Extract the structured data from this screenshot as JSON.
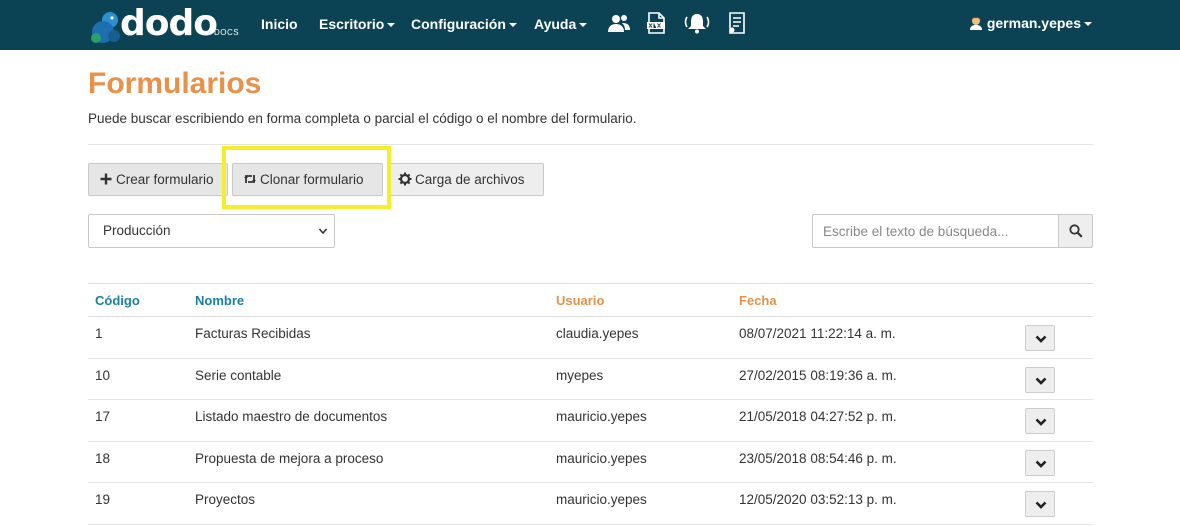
{
  "brand": {
    "name": "dodo",
    "sub": "DOCS"
  },
  "nav": {
    "items": [
      {
        "label": "Inicio",
        "has_caret": false
      },
      {
        "label": "Escritorio",
        "has_caret": true
      },
      {
        "label": "Configuración",
        "has_caret": true
      },
      {
        "label": "Ayuda",
        "has_caret": true
      }
    ],
    "icons": [
      "users-icon",
      "xlsx-file-icon",
      "bell-icon",
      "document-list-icon"
    ],
    "user": "german.yepes"
  },
  "page": {
    "title": "Formularios",
    "description": "Puede buscar escribiendo en forma completa o parcial el código o el nombre del formulario."
  },
  "toolbar": {
    "create_label": "Crear formulario",
    "clone_label": "Clonar formulario",
    "upload_label": "Carga de archivos"
  },
  "filter": {
    "selected": "Producción"
  },
  "search": {
    "placeholder": "Escribe el texto de búsqueda...",
    "value": ""
  },
  "table": {
    "headers": {
      "code": "Código",
      "name": "Nombre",
      "user": "Usuario",
      "date": "Fecha"
    },
    "rows": [
      {
        "code": "1",
        "name": "Facturas Recibidas",
        "user": "claudia.yepes",
        "date": "08/07/2021 11:22:14 a. m."
      },
      {
        "code": "10",
        "name": "Serie contable",
        "user": "myepes",
        "date": "27/02/2015 08:19:36 a. m."
      },
      {
        "code": "17",
        "name": "Listado maestro de documentos",
        "user": "mauricio.yepes",
        "date": "21/05/2018 04:27:52 p. m."
      },
      {
        "code": "18",
        "name": "Propuesta de mejora a proceso",
        "user": "mauricio.yepes",
        "date": "23/05/2018 08:54:46 p. m."
      },
      {
        "code": "19",
        "name": "Proyectos",
        "user": "mauricio.yepes",
        "date": "12/05/2020 03:52:13 p. m."
      }
    ]
  },
  "colors": {
    "navbar": "#0c4354",
    "accent_orange": "#e8914a",
    "accent_blue": "#1a7fa8",
    "highlight": "#f5ee2a"
  }
}
